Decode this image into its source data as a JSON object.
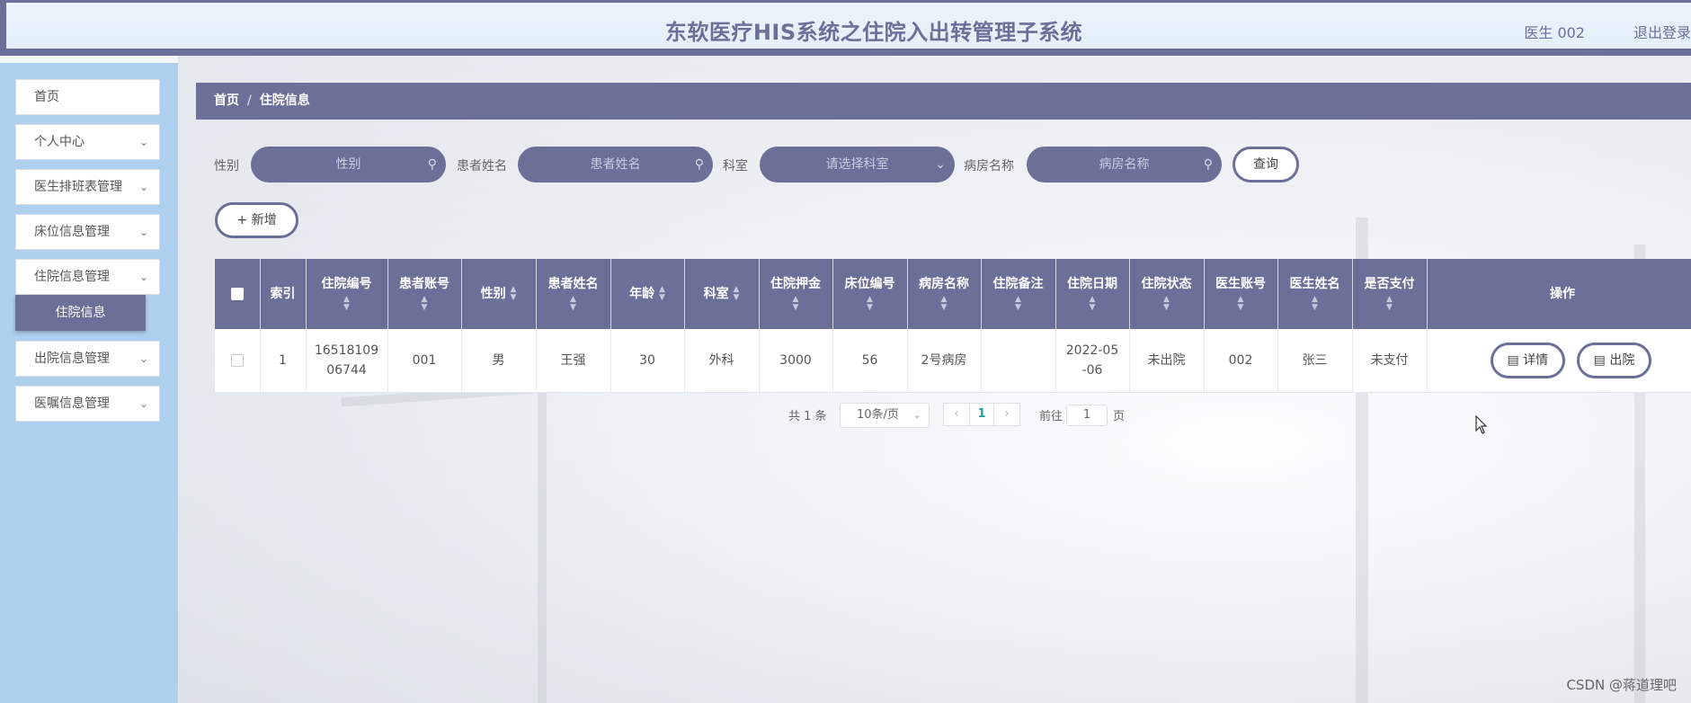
{
  "header": {
    "title": "东软医疗HIS系统之住院入出转管理子系统",
    "user": "医生 002",
    "logout": "退出登录"
  },
  "sidebar": {
    "items": [
      {
        "label": "首页"
      },
      {
        "label": "个人中心"
      },
      {
        "label": "医生排班表管理"
      },
      {
        "label": "床位信息管理"
      },
      {
        "label": "住院信息管理"
      },
      {
        "label": "出院信息管理"
      },
      {
        "label": "医嘱信息管理"
      }
    ],
    "active_sub": "住院信息"
  },
  "breadcrumb": {
    "home": "首页",
    "sep": "/",
    "current": "住院信息"
  },
  "search": {
    "gender_label": "性别",
    "gender_placeholder": "性别",
    "name_label": "患者姓名",
    "name_placeholder": "患者姓名",
    "dept_label": "科室",
    "dept_placeholder": "请选择科室",
    "ward_label": "病房名称",
    "ward_placeholder": "病房名称",
    "query_button": "查询"
  },
  "add_button": "+ 新增",
  "table": {
    "headers": [
      "索引",
      "住院编号",
      "患者账号",
      "性别",
      "患者姓名",
      "年龄",
      "科室",
      "住院押金",
      "床位编号",
      "病房名称",
      "住院备注",
      "住院日期",
      "住院状态",
      "医生账号",
      "医生姓名",
      "是否支付",
      "操作"
    ],
    "rows": [
      {
        "index": "1",
        "admission_no": "1651810906744",
        "patient_account": "001",
        "gender": "男",
        "patient_name": "王强",
        "age": "30",
        "department": "外科",
        "deposit": "3000",
        "bed_no": "56",
        "ward": "2号病房",
        "remark": "",
        "admission_date": "2022-05-06",
        "status": "未出院",
        "doctor_account": "002",
        "doctor_name": "张三",
        "paid": "未支付",
        "detail_button": "详情",
        "discharge_button": "出院"
      }
    ]
  },
  "pagination": {
    "total": "共 1 条",
    "page_size": "10条/页",
    "current_page": "1",
    "goto_prefix": "前往",
    "goto_value": "1",
    "goto_suffix": "页"
  },
  "watermark": "CSDN @蒋道理吧",
  "colors": {
    "primary": "#6c7098",
    "sidebar": "#aecfee",
    "header_bg": "#e2effa"
  }
}
